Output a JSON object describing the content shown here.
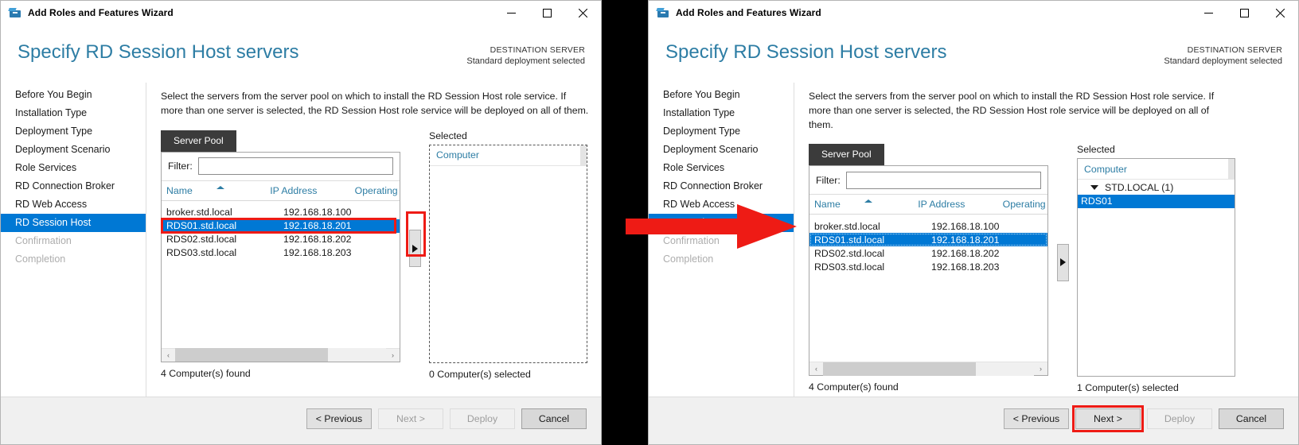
{
  "window": {
    "title": "Add Roles and Features Wizard",
    "controls": {
      "minimize": "minimize-icon",
      "maximize": "maximize-icon",
      "close": "close-icon"
    }
  },
  "header": {
    "page_title": "Specify RD Session Host servers",
    "destination_label": "DESTINATION SERVER",
    "destination_value": "Standard deployment selected"
  },
  "nav": {
    "items": [
      {
        "label": "Before You Begin",
        "state": "normal"
      },
      {
        "label": "Installation Type",
        "state": "normal"
      },
      {
        "label": "Deployment Type",
        "state": "normal"
      },
      {
        "label": "Deployment Scenario",
        "state": "normal"
      },
      {
        "label": "Role Services",
        "state": "normal"
      },
      {
        "label": "RD Connection Broker",
        "state": "normal"
      },
      {
        "label": "RD Web Access",
        "state": "normal"
      },
      {
        "label": "RD Session Host",
        "state": "active"
      },
      {
        "label": "Confirmation",
        "state": "disabled"
      },
      {
        "label": "Completion",
        "state": "disabled"
      }
    ]
  },
  "content": {
    "intro": "Select the servers from the server pool on which to install the RD Session Host role service. If more than one server is selected, the RD Session Host role service will be deployed on all of them.",
    "tab_label": "Server Pool",
    "filter_label": "Filter:",
    "filter_value": "",
    "filter_placeholder": "",
    "columns": {
      "name": "Name",
      "ip": "IP Address",
      "os": "Operating"
    },
    "rows": [
      {
        "name": "broker.std.local",
        "ip": "192.168.18.100",
        "selected": false
      },
      {
        "name": "RDS01.std.local",
        "ip": "192.168.18.201",
        "selected": true
      },
      {
        "name": "RDS02.std.local",
        "ip": "192.168.18.202",
        "selected": false
      },
      {
        "name": "RDS03.std.local",
        "ip": "192.168.18.203",
        "selected": false
      }
    ],
    "scroll_left_arrow": "‹",
    "scroll_right_arrow": "›",
    "move_button": "move-right-arrow-icon"
  },
  "left_window": {
    "found_count": "4 Computer(s) found",
    "selected_count": "0 Computer(s) selected",
    "selected_header": "Selected",
    "selected_column": "Computer",
    "selected_items": []
  },
  "right_window": {
    "found_count": "4 Computer(s) found",
    "selected_count": "1 Computer(s) selected",
    "selected_header": "Selected",
    "selected_column": "Computer",
    "group_label": "STD.LOCAL (1)",
    "selected_items": [
      "RDS01"
    ]
  },
  "buttons": {
    "previous": "< Previous",
    "next": "Next >",
    "deploy": "Deploy",
    "cancel": "Cancel"
  },
  "annotations": {
    "left_highlight": "red-box-on-selected-server-row",
    "left_move_highlight": "red-box-on-move-right-button",
    "flow_arrow": "red-flow-arrow",
    "right_next_highlight": "red-box-on-next-button"
  },
  "colors": {
    "accent": "#0078d4",
    "title_blue": "#2d7da4",
    "annotation_red": "#ee1b15",
    "tab_dark": "#3b3b3b"
  }
}
